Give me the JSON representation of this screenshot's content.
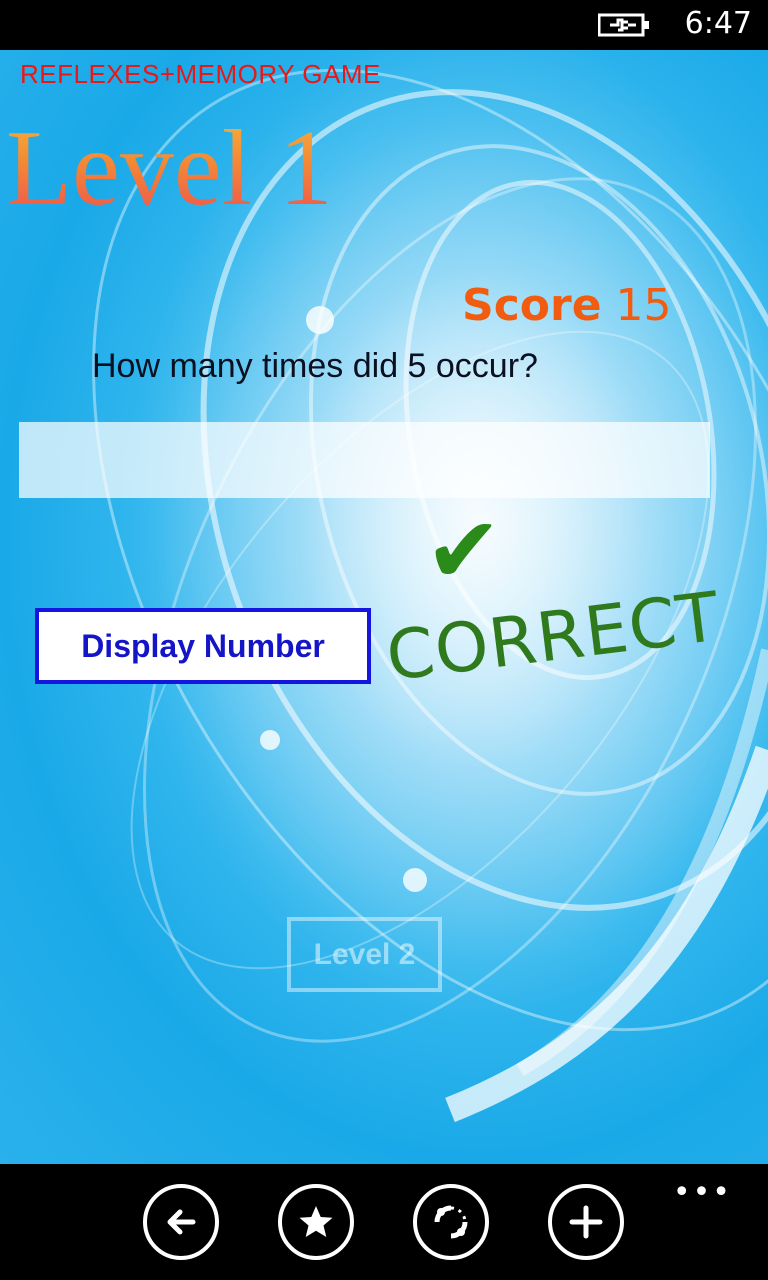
{
  "status": {
    "time": "6:47",
    "battery_icon": "battery-charging-icon"
  },
  "app": {
    "title": "REFLEXES+MEMORY GAME"
  },
  "game": {
    "level_title": "Level 1",
    "score_label": "Score",
    "score_value": "15",
    "question": "How many times did 5 occur?",
    "answer_value": "",
    "display_button_label": "Display Number",
    "result_icon": "check-icon",
    "result_text": "CORRECT",
    "next_level_label": "Level 2"
  },
  "app_bar": {
    "buttons": [
      {
        "icon": "back-arrow-icon"
      },
      {
        "icon": "star-icon"
      },
      {
        "icon": "sync-icon"
      },
      {
        "icon": "add-icon"
      }
    ],
    "more_icon": "more-dots-icon"
  },
  "colors": {
    "title_red": "#e81818",
    "score_orange": "#f25c10",
    "button_blue": "#1515e0",
    "correct_green": "#2f7a1c",
    "background_blue": "#1aa9e8"
  }
}
